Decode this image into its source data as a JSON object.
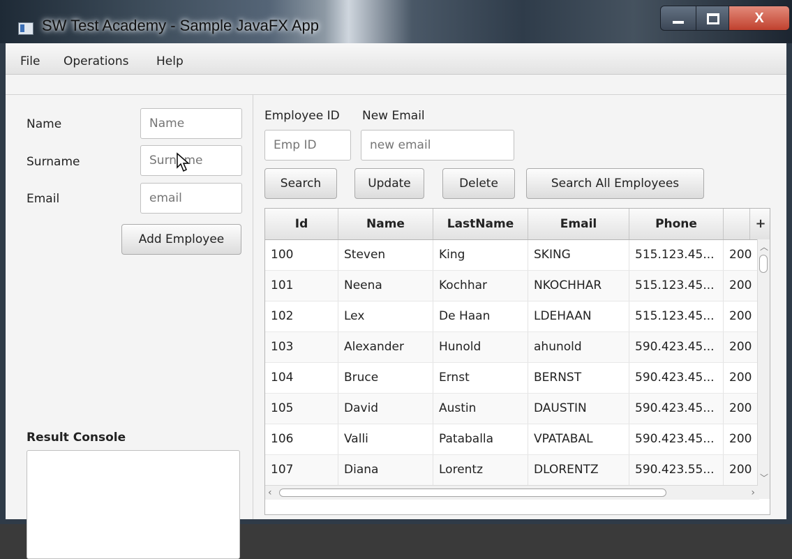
{
  "window": {
    "title": "SW Test Academy - Sample JavaFX App",
    "minimize_icon": "minimize-icon",
    "maximize_icon": "maximize-icon",
    "close_glyph": "X"
  },
  "menu": {
    "items": [
      {
        "label": "File"
      },
      {
        "label": "Operations"
      },
      {
        "label": "Help"
      }
    ]
  },
  "employee_form": {
    "name_label": "Name",
    "name_placeholder": "Name",
    "surname_label": "Surname",
    "surname_placeholder": "Surname",
    "email_label": "Email",
    "email_placeholder": "email",
    "add_button": "Add Employee"
  },
  "console": {
    "label": "Result Console",
    "value": ""
  },
  "update_form": {
    "empid_label": "Employee ID",
    "empid_placeholder": "Emp ID",
    "email_label": "New Email",
    "email_placeholder": "new email"
  },
  "actions": {
    "search": "Search",
    "update": "Update",
    "delete": "Delete",
    "search_all": "Search All Employees"
  },
  "table": {
    "columns": [
      "Id",
      "Name",
      "LastName",
      "Email",
      "Phone",
      ""
    ],
    "menu_button": "+",
    "rows": [
      [
        "100",
        "Steven",
        "King",
        "SKING",
        "515.123.45...",
        "200"
      ],
      [
        "101",
        "Neena",
        "Kochhar",
        "NKOCHHAR",
        "515.123.45...",
        "200"
      ],
      [
        "102",
        "Lex",
        "De Haan",
        "LDEHAAN",
        "515.123.45...",
        "200"
      ],
      [
        "103",
        "Alexander",
        "Hunold",
        "ahunold",
        "590.423.45...",
        "200"
      ],
      [
        "104",
        "Bruce",
        "Ernst",
        "BERNST",
        "590.423.45...",
        "200"
      ],
      [
        "105",
        "David",
        "Austin",
        "DAUSTIN",
        "590.423.45...",
        "200"
      ],
      [
        "106",
        "Valli",
        "Pataballa",
        "VPATABAL",
        "590.423.45...",
        "200"
      ],
      [
        "107",
        "Diana",
        "Lorentz",
        "DLORENTZ",
        "590.423.55...",
        "200"
      ]
    ]
  }
}
